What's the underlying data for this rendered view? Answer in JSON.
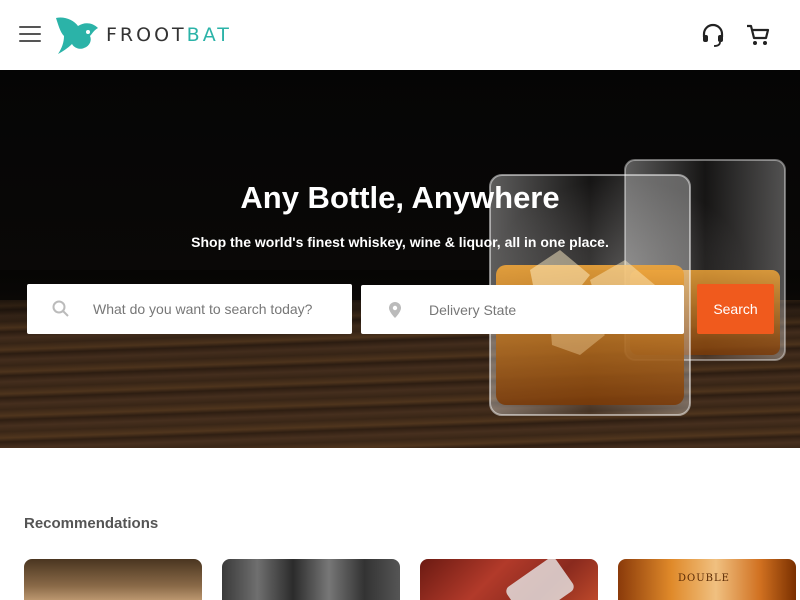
{
  "header": {
    "menu_icon": "hamburger-menu-icon",
    "logo": {
      "text_part1": "FROOT",
      "text_part2": "BAT",
      "brand_color": "#2bb3a8"
    },
    "support_icon": "headset-icon",
    "cart_icon": "shopping-cart-icon"
  },
  "hero": {
    "title": "Any Bottle, Anywhere",
    "subtitle": "Shop the world's finest whiskey, wine & liquor, all in one place.",
    "search": {
      "placeholder": "What do you want to search today?",
      "value": "",
      "icon": "search-icon"
    },
    "delivery": {
      "placeholder": "Delivery State",
      "value": "",
      "icon": "location-pin-icon"
    },
    "search_button": "Search",
    "accent_color": "#f05a1d"
  },
  "recommendations": {
    "title": "Recommendations",
    "cards": [
      {
        "label": ""
      },
      {
        "label": ""
      },
      {
        "label": ""
      },
      {
        "label": "DOUBLE"
      }
    ]
  }
}
